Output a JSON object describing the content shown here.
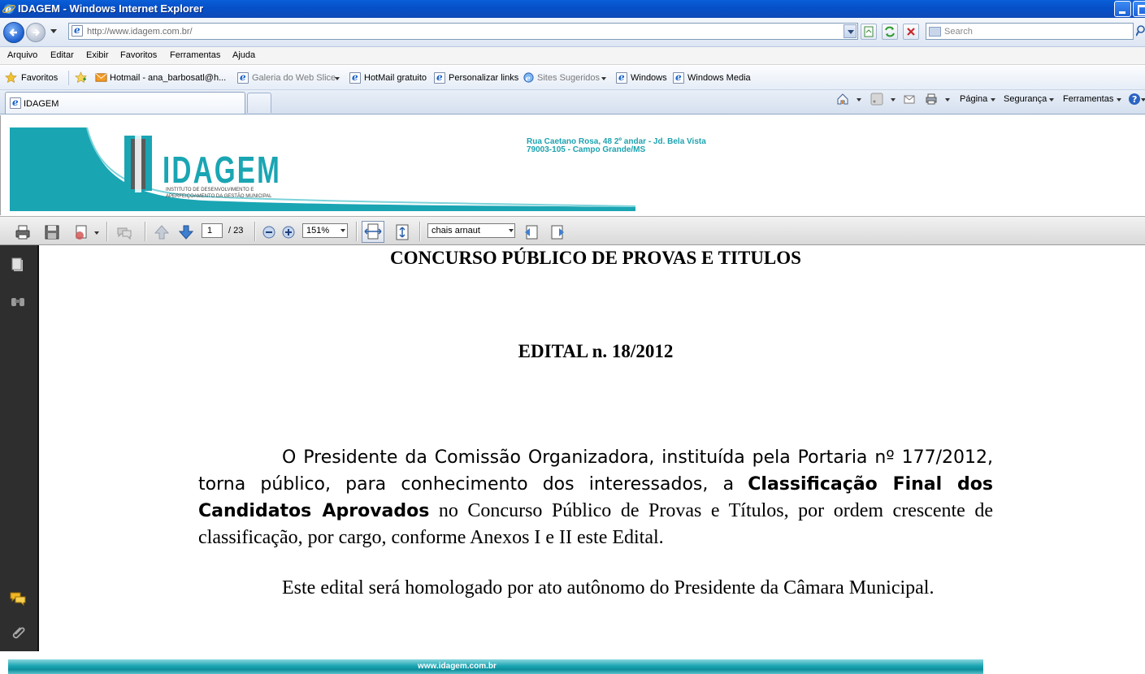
{
  "window": {
    "title": "IDAGEM - Windows Internet Explorer"
  },
  "navigation": {
    "url": "http://www.idagem.com.br/",
    "search_placeholder": "Search"
  },
  "menu": [
    "Arquivo",
    "Editar",
    "Exibir",
    "Favoritos",
    "Ferramentas",
    "Ajuda"
  ],
  "favorites_bar": {
    "favorites_label": "Favoritos",
    "items": [
      "Hotmail - ana_barbosatl@h...",
      "Galeria do Web Slice",
      "HotMail gratuito",
      "Personalizar links",
      "Sites Sugeridos",
      "Windows",
      "Windows Media"
    ]
  },
  "tabs": [
    {
      "label": "IDAGEM"
    }
  ],
  "command_bar": {
    "page": "Página",
    "security": "Segurança",
    "tools": "Ferramentas"
  },
  "site_header": {
    "logo_text": "IDAGEM",
    "logo_subtitle_1": "INSTITUTO DE DESENVOLVIMENTO E",
    "logo_subtitle_2": "APERFEIÇOAMENTO DA GESTÃO MUNICIPAL",
    "address_line_1": "Rua Caetano Rosa, 48 2º andar - Jd. Bela Vista",
    "address_line_2": "79003-105 - Campo Grande/MS"
  },
  "pdf_toolbar": {
    "current_page": "1",
    "total_pages": "/ 23",
    "zoom": "151%",
    "find_text": "chais arnaut"
  },
  "document": {
    "title": "CONCURSO PÚBLICO DE PROVAS E TITULOS",
    "edital": "EDITAL n. 18/2012",
    "p1_a": "O Presidente da Comissão Organizadora, instituída pela Portaria nº 177/2012, torna público, para conhecimento dos interessados, a",
    "p1_bold": "Classificação Final dos Candidatos Aprovados",
    "p1_b": "no Concurso Público de Provas e Títulos, por ordem crescente de classificação, por cargo, conforme Anexos I e II este Edital.",
    "p2": "Este edital será homologado por ato autônomo do Presidente da Câmara Municipal."
  },
  "footer": {
    "url": "www.idagem.com.br"
  },
  "colors": {
    "brand_teal": "#1aa5b3",
    "xp_blue": "#0550c8"
  }
}
